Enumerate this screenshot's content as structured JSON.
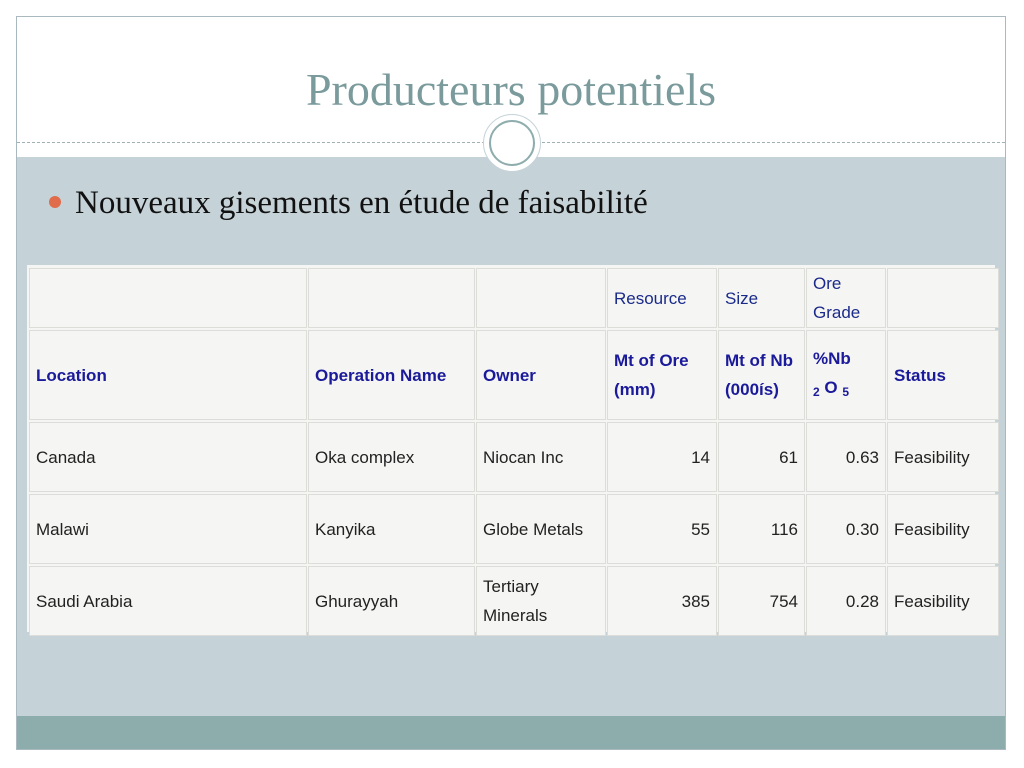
{
  "slide": {
    "title": "Producteurs potentiels",
    "bullet": "Nouveaux gisements en étude de faisabilité"
  },
  "colors": {
    "title": "#7a9a9c",
    "bullet_dot": "#e06c4c",
    "content_background": "#c5d2d8",
    "footer_band": "#8dacac",
    "header_text": "#1a1a9a"
  },
  "table": {
    "top_row": [
      "",
      "",
      "",
      "Resource",
      "Size",
      "Ore Grade",
      ""
    ],
    "headers": {
      "location": "Location",
      "operation_name": "Operation Name",
      "owner": "Owner",
      "resource": "Mt of Ore (mm)",
      "size": "Mt of Nb (000ís)",
      "grade_prefix": "%Nb",
      "grade_sub1": "2",
      "grade_o": "O",
      "grade_sub2": "5",
      "status": "Status"
    },
    "rows": [
      {
        "location": "Canada",
        "operation": "Oka complex",
        "owner": "Niocan Inc",
        "resource": "14",
        "size": "61",
        "grade": "0.63",
        "status": "Feasibility"
      },
      {
        "location": "Malawi",
        "operation": "Kanyika",
        "owner": "Globe Metals",
        "resource": "55",
        "size": "116",
        "grade": "0.30",
        "status": "Feasibility"
      },
      {
        "location": "Saudi Arabia",
        "operation": "Ghurayyah",
        "owner": "Tertiary Minerals",
        "resource": "385",
        "size": "754",
        "grade": "0.28",
        "status": "Feasibility"
      }
    ]
  }
}
